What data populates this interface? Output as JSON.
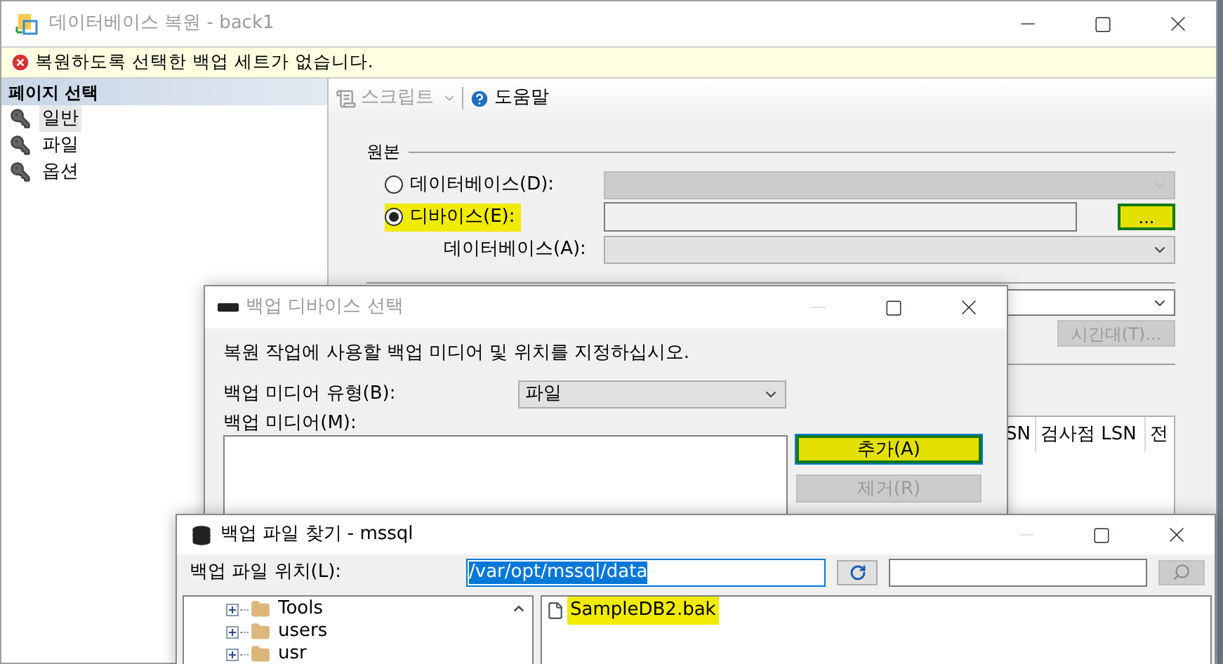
{
  "main_window": {
    "title": "데이터베이스 복원 - back1",
    "error": "복원하도록 선택한 백업 세트가 없습니다.",
    "sidebar": {
      "title": "페이지 선택",
      "items": [
        {
          "label": "일반",
          "selected": true
        },
        {
          "label": "파일",
          "selected": false
        },
        {
          "label": "옵션",
          "selected": false
        }
      ]
    },
    "toolbar": {
      "script": "스크립트",
      "help": "도움말"
    },
    "source": {
      "title": "원본",
      "options": [
        {
          "label": "데이터베이스(D):",
          "selected": false,
          "highlighted": false
        },
        {
          "label": "디바이스(E):",
          "selected": true,
          "highlighted": true
        }
      ],
      "browse_button": "...",
      "browse_highlighted": true,
      "database_label": "데이터베이스(A):"
    },
    "destination": {
      "timeline_button": "시간대(T)..."
    },
    "grid_columns": [
      "SN",
      "검사점 LSN",
      "전"
    ]
  },
  "device_dialog": {
    "title": "백업 디바이스 선택",
    "instruction": "복원 작업에 사용할 백업 미디어 및 위치를 지정하십시오.",
    "media_type_label": "백업 미디어 유형(B):",
    "media_type": "파일",
    "media_label": "백업 미디어(M):",
    "buttons": [
      {
        "label": "추가(A)",
        "disabled": false,
        "highlighted": true
      },
      {
        "label": "제거(R)",
        "disabled": true,
        "highlighted": false
      }
    ]
  },
  "file_dialog": {
    "title": "백업 파일 찾기 - mssql",
    "location_label": "백업 파일 위치(L):",
    "location": "/var/opt/mssql/data",
    "folders": [
      {
        "label": "Tools"
      },
      {
        "label": "users"
      },
      {
        "label": "usr"
      }
    ],
    "files": [
      {
        "name": "SampleDB2.bak",
        "highlighted": true
      }
    ]
  }
}
